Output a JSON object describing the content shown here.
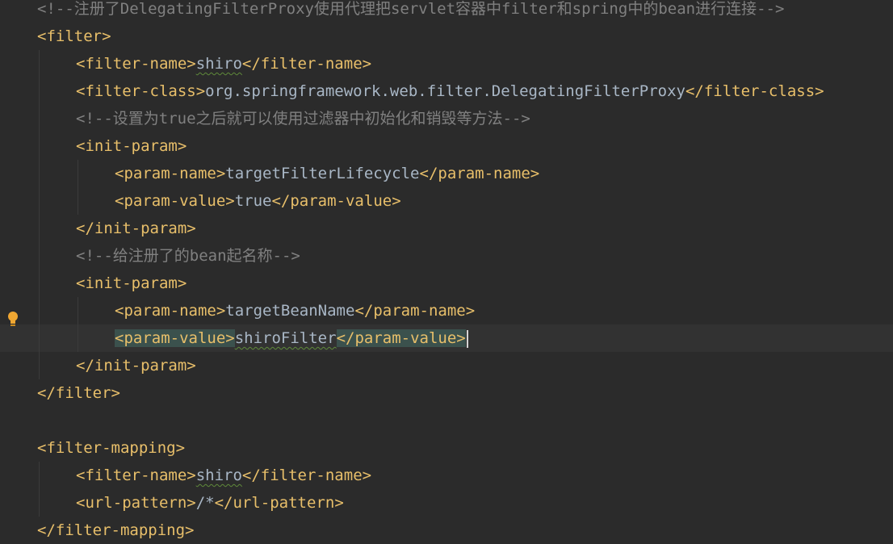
{
  "lines": [
    {
      "indent": 0,
      "kind": "comment",
      "text": "<!--注册了DelegatingFilterProxy使用代理把servlet容器中filter和spring中的bean进行连接-->"
    },
    {
      "indent": 0,
      "kind": "tag",
      "text": "<filter>"
    },
    {
      "indent": 1,
      "kind": "element",
      "open": "<filter-name>",
      "value": "shiro",
      "close": "</filter-name>",
      "typo": true
    },
    {
      "indent": 1,
      "kind": "element",
      "open": "<filter-class>",
      "value": "org.springframework.web.filter.DelegatingFilterProxy",
      "close": "</filter-class>"
    },
    {
      "indent": 1,
      "kind": "comment",
      "text": "<!--设置为true之后就可以使用过滤器中初始化和销毁等方法-->"
    },
    {
      "indent": 1,
      "kind": "tag",
      "text": "<init-param>"
    },
    {
      "indent": 2,
      "kind": "element",
      "open": "<param-name>",
      "value": "targetFilterLifecycle",
      "close": "</param-name>"
    },
    {
      "indent": 2,
      "kind": "element",
      "open": "<param-value>",
      "value": "true",
      "close": "</param-value>"
    },
    {
      "indent": 1,
      "kind": "tag",
      "text": "</init-param>"
    },
    {
      "indent": 1,
      "kind": "comment",
      "text": "<!--给注册了的bean起名称-->"
    },
    {
      "indent": 1,
      "kind": "tag",
      "text": "<init-param>"
    },
    {
      "indent": 2,
      "kind": "element",
      "open": "<param-name>",
      "value": "targetBeanName",
      "close": "</param-name>"
    },
    {
      "indent": 2,
      "kind": "element",
      "open": "<param-value>",
      "value": "shiroFilter",
      "close": "</param-value>",
      "typo": true,
      "current": true
    },
    {
      "indent": 1,
      "kind": "tag",
      "text": "</init-param>"
    },
    {
      "indent": 0,
      "kind": "tag",
      "text": "</filter>"
    },
    {
      "indent": 0,
      "kind": "blank",
      "text": ""
    },
    {
      "indent": 0,
      "kind": "tag",
      "text": "<filter-mapping>"
    },
    {
      "indent": 1,
      "kind": "element",
      "open": "<filter-name>",
      "value": "shiro",
      "close": "</filter-name>",
      "typo": true
    },
    {
      "indent": 1,
      "kind": "element",
      "open": "<url-pattern>",
      "value": "/*",
      "close": "</url-pattern>"
    },
    {
      "indent": 0,
      "kind": "tag",
      "text": "</filter-mapping>"
    }
  ],
  "gutter": {
    "icon": "lightbulb-icon",
    "color": "#f0a732"
  },
  "theme": {
    "background": "#2b2b2b",
    "tag": "#e8bf6a",
    "text": "#a9b7c6",
    "comment": "#808080",
    "match_highlight": "#3b514d"
  }
}
